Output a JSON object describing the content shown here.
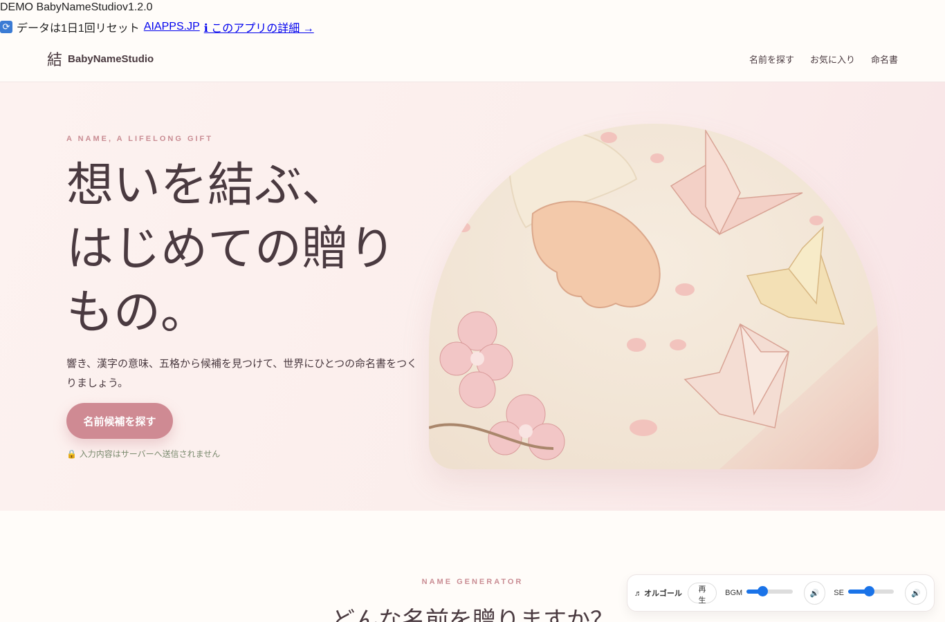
{
  "demo": {
    "label": "DEMO BabyNameStudiov1.2.0"
  },
  "topbar": {
    "reset_text": "データは1日1回リセット",
    "site_link": "AIAPPS.JP",
    "details_link": "ℹ このアプリの詳細 →"
  },
  "header": {
    "logo_mark": "結",
    "brand": "BabyNameStudio",
    "nav": [
      "名前を探す",
      "お気に入り",
      "命名書"
    ]
  },
  "hero": {
    "eyebrow": "A NAME, A LIFELONG GIFT",
    "title_lines": [
      "想いを結ぶ、",
      "はじめての贈り",
      "もの。"
    ],
    "lede": "響き、漢字の意味、五格から候補を見つけて、世界にひとつの命名書をつくりましょう。",
    "cta": "名前候補を探す",
    "privacy": "🔒 入力内容はサーバーへ送信されません"
  },
  "section": {
    "eyebrow": "NAME GENERATOR",
    "title": "どんな名前を贈りますか？"
  },
  "player": {
    "label": "♬ オルゴール",
    "play": "再生",
    "bgm_label": "BGM",
    "bgm_level": 0.35,
    "se_label": "SE",
    "se_level": 0.45,
    "mute_icon": "🔊"
  }
}
